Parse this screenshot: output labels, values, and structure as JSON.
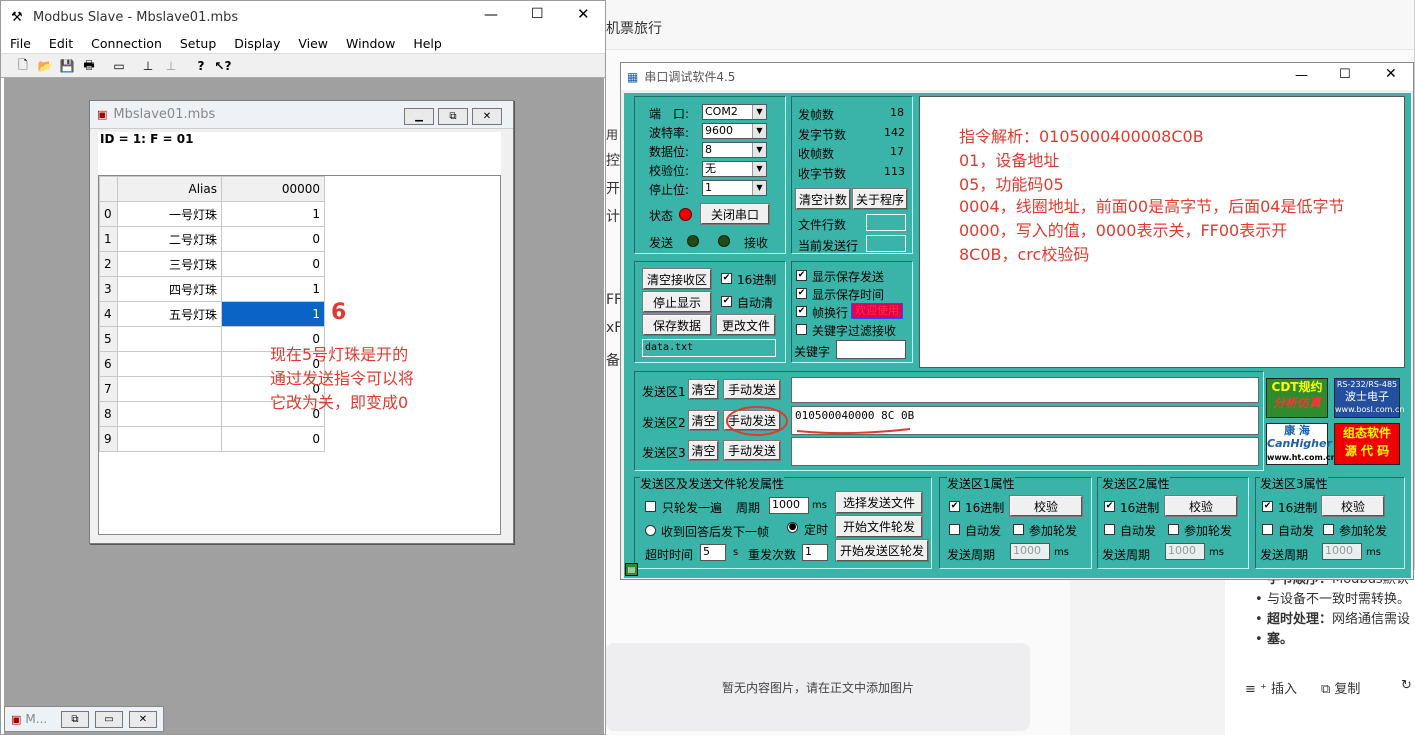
{
  "background": {
    "top_text": "机票旅行",
    "fragments": [
      "用",
      "控",
      "开关",
      "计二",
      "FF",
      "xFF",
      "备"
    ],
    "bullets": [
      {
        "label": "字节顺序：",
        "text": "Modbus默认"
      },
      {
        "label": "",
        "text": "与设备不一致时需转换。"
      },
      {
        "label": "超时处理：",
        "text": "网络通信需设"
      },
      {
        "label": "",
        "text": "塞。"
      }
    ],
    "no_image_text": "暂无内容图片，请在正文中添加图片",
    "insert_label": "插入",
    "copy_label": "复制"
  },
  "modbus": {
    "title": "Modbus Slave - Mbslave01.mbs",
    "menu": [
      "File",
      "Edit",
      "Connection",
      "Setup",
      "Display",
      "View",
      "Window",
      "Help"
    ],
    "child_title": "Mbslave01.mbs",
    "info": "ID = 1: F = 01",
    "col_alias": "Alias",
    "col_addr": "00000",
    "rows": [
      {
        "n": "0",
        "alias": "一号灯珠",
        "value": "1"
      },
      {
        "n": "1",
        "alias": "二号灯珠",
        "value": "0"
      },
      {
        "n": "2",
        "alias": "三号灯珠",
        "value": "0"
      },
      {
        "n": "3",
        "alias": "四号灯珠",
        "value": "1"
      },
      {
        "n": "4",
        "alias": "五号灯珠",
        "value": "1"
      },
      {
        "n": "5",
        "alias": "",
        "value": "0"
      },
      {
        "n": "6",
        "alias": "",
        "value": "0"
      },
      {
        "n": "7",
        "alias": "",
        "value": "0"
      },
      {
        "n": "8",
        "alias": "",
        "value": "0"
      },
      {
        "n": "9",
        "alias": "",
        "value": "0"
      }
    ],
    "minimized_title": "M..."
  },
  "serial": {
    "title": "串口调试软件4.5",
    "port_label": "端　口:",
    "port": "COM2",
    "baud_label": "波特率:",
    "baud": "9600",
    "data_label": "数据位:",
    "data_bits": "8",
    "parity_label": "校验位:",
    "parity": "无",
    "stop_label": "停止位:",
    "stop_bits": "1",
    "status_label": "状态",
    "close_port": "关闭串口",
    "send_label": "发送",
    "recv_label": "接收",
    "stats": [
      {
        "label": "发帧数",
        "value": "18"
      },
      {
        "label": "发字节数",
        "value": "142"
      },
      {
        "label": "收帧数",
        "value": "17"
      },
      {
        "label": "收字节数",
        "value": "113"
      }
    ],
    "clear_count": "清空计数",
    "about": "关于程序",
    "file_lines": "文件行数",
    "current_line": "当前发送行",
    "clear_recv": "清空接收区",
    "hex16": "16进制",
    "stop_display": "停止显示",
    "auto_clear": "自动清",
    "save_data": "保存数据",
    "change_file": "更改文件",
    "file_name": "data.txt",
    "show_save_send": "显示保存发送",
    "show_save_time": "显示保存时间",
    "frame_newline": "帧换行",
    "welcome": "欢迎使用",
    "keyword_filter": "关键字过滤接收",
    "keyword": "关键字",
    "annotation_lines": [
      "指令解析：0105000400008C0B",
      "01，设备地址",
      "05，功能码05",
      "0004，线圈地址，前面00是高字节，后面04是低字节",
      "0000，写入的值，0000表示关，FF00表示开",
      "8C0B，crc校验码"
    ],
    "send_areas": [
      {
        "label": "发送区1",
        "clear": "清空",
        "send": "手动发送",
        "content": ""
      },
      {
        "label": "发送区2",
        "clear": "清空",
        "send": "手动发送",
        "content": "010500040000 8C 0B"
      },
      {
        "label": "发送区3",
        "clear": "清空",
        "send": "手动发送",
        "content": ""
      }
    ],
    "ads": [
      "CDT规约",
      "分析仿真",
      "RS-232/RS-485",
      "波士电子",
      "www.bosl.com.cn",
      "康 海",
      "CanHigher",
      "www.ht.com.cn",
      "组态软件",
      "源 代 码"
    ],
    "rotate_group": "发送区及发送文件轮发属性",
    "only_once": "只轮发一遍",
    "period": "周期",
    "period_value": "1000",
    "ms": "ms",
    "select_file": "选择发送文件",
    "recv_next": "收到回答后发下一帧",
    "timed": "定时",
    "start_file_rotate": "开始文件轮发",
    "timeout": "超时时间",
    "timeout_value": "5",
    "s": "s",
    "resend": "重发次数",
    "resend_value": "1",
    "start_area_rotate": "开始发送区轮发",
    "area_props": [
      {
        "title": "发送区1属性",
        "hex": "16进制",
        "check": "校验",
        "auto": "自动发",
        "rotate": "参加轮发",
        "period": "发送周期",
        "period_value": "1000",
        "ms": "ms"
      },
      {
        "title": "发送区2属性",
        "hex": "16进制",
        "check": "校验",
        "auto": "自动发",
        "rotate": "参加轮发",
        "period": "发送周期",
        "period_value": "1000",
        "ms": "ms"
      },
      {
        "title": "发送区3属性",
        "hex": "16进制",
        "check": "校验",
        "auto": "自动发",
        "rotate": "参加轮发",
        "period": "发送周期",
        "period_value": "1000",
        "ms": "ms"
      }
    ]
  },
  "annotations": {
    "note": [
      "现在5号灯珠是开的",
      "通过发送指令可以将",
      "它改为关，即变成0"
    ],
    "circled_number": "6"
  }
}
